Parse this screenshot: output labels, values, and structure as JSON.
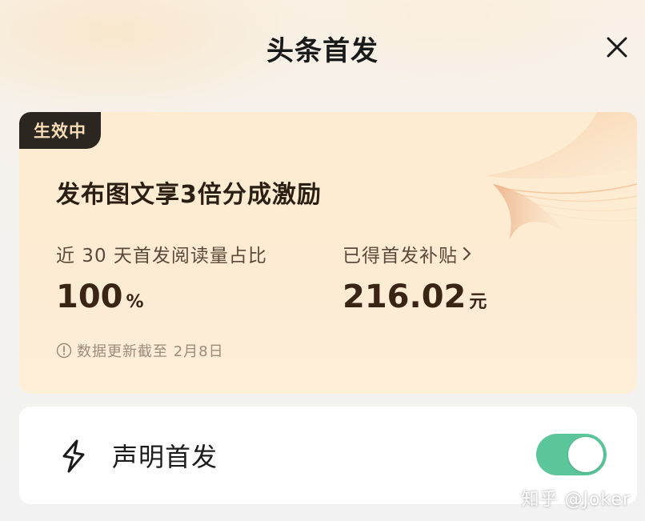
{
  "header": {
    "title": "头条首发",
    "close_icon": "close-icon"
  },
  "promo": {
    "badge": "生效中",
    "headline": "发布图文享3倍分成激励",
    "share_label": "近 30 天首发阅读量占比",
    "share_value": "100",
    "share_unit": "%",
    "subsidy_label": "已得首发补贴",
    "subsidy_value": "216.02",
    "subsidy_unit": "元",
    "update_note": "数据更新截至 2月8日"
  },
  "setting": {
    "label": "声明首发",
    "icon": "lightning-icon",
    "toggle_on": true,
    "toggle_color": "#5bc69a"
  },
  "watermark": "知乎 @Joker",
  "colors": {
    "badge_bg": "#2c2621",
    "badge_text": "#f6ddb6",
    "card_bg": "#fdecd2"
  }
}
